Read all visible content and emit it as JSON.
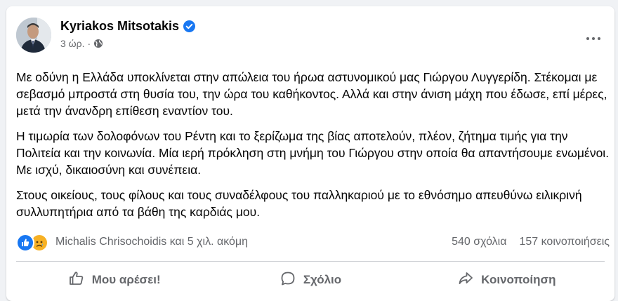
{
  "post": {
    "author": "Kyriakos Mitsotakis",
    "time": "3 ώρ.",
    "separator": "·",
    "paragraphs": [
      "Με οδύνη η Ελλάδα υποκλίνεται στην απώλεια του ήρωα αστυνομικού μας Γιώργου Λυγγερίδη. Στέκομαι με σεβασμό μπροστά στη θυσία του, την ώρα του καθήκοντος. Αλλά και στην άνιση μάχη που έδωσε, επί μέρες, μετά την άνανδρη επίθεση εναντίον του.",
      "Η τιμωρία των δολοφόνων του Ρέντη και το ξερίζωμα της βίας αποτελούν, πλέον, ζήτημα τιμής για την Πολιτεία και την κοινωνία. Μία ιερή πρόκληση στη μνήμη του Γιώργου στην οποία θα απαντήσουμε ενωμένοι. Με ισχύ, δικαιοσύνη και συνέπεια.",
      "Στους οικείους, τους φίλους και τους συναδέλφους του παλληκαριού με το εθνόσημο απευθύνω ειλικρινή συλλυπητήρια από τα βάθη της καρδιάς μου."
    ]
  },
  "reactions": {
    "names": "Michalis Chrisochoidis και 5 χιλ. ακόμη",
    "comments": "540 σχόλια",
    "shares": "157 κοινοποιήσεις",
    "icons": [
      "like-icon",
      "sad-icon"
    ]
  },
  "actions": {
    "like": "Μου αρέσει!",
    "comment": "Σχόλιο",
    "share": "Κοινοποίηση"
  },
  "colors": {
    "verified": "#1877f2",
    "like_reaction": "#1877f2",
    "sad_reaction": "#f7b125",
    "secondary_text": "#65676b"
  }
}
